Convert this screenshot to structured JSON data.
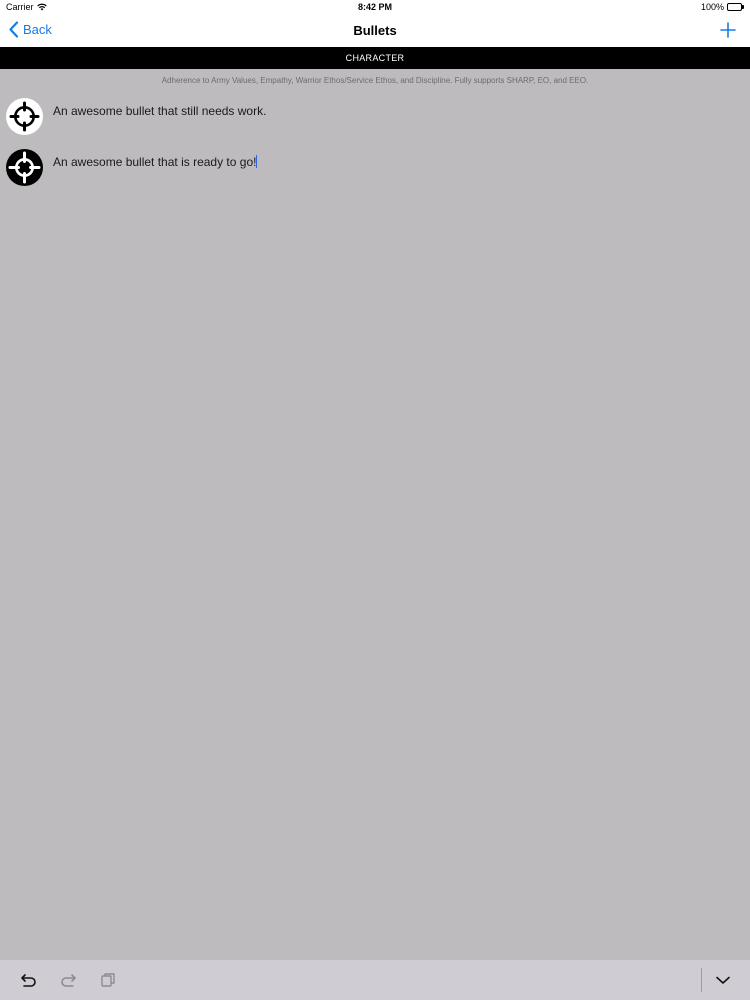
{
  "status_bar": {
    "carrier": "Carrier",
    "time": "8:42 PM",
    "battery": "100%",
    "battery_level": 1.0
  },
  "nav": {
    "back_label": "Back",
    "title": "Bullets",
    "back_icon": "chevron-left-icon",
    "add_icon": "plus-icon"
  },
  "section": {
    "title": "CHARACTER",
    "description": "Adherence to Army Values, Empathy, Warrior Ethos/Service Ethos, and Discipline. Fully supports SHARP, EO, and EEO."
  },
  "bullets": [
    {
      "text": "An awesome bullet that still needs work.",
      "status_icon": "crosshair-icon",
      "ready": false
    },
    {
      "text": "An awesome bullet that is ready to go!",
      "status_icon": "crosshair-filled-icon",
      "ready": true
    }
  ],
  "toolbar": {
    "undo_icon": "undo-icon",
    "redo_icon": "redo-icon",
    "copy_icon": "copy-icon",
    "dismiss_icon": "chevron-down-icon"
  },
  "colors": {
    "accent": "#1a7ae6",
    "background": "#bdbbbe",
    "header": "#000000",
    "toolbar": "#cfcdd3"
  }
}
